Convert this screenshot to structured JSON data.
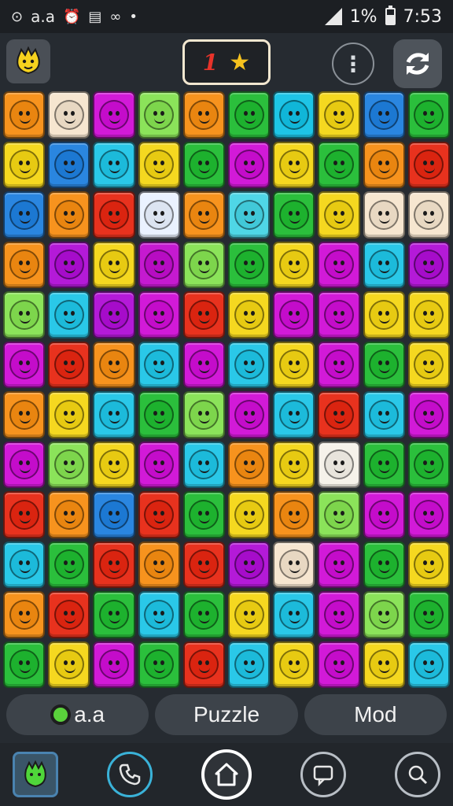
{
  "status_bar": {
    "left_text": "a.a",
    "battery": "1%",
    "time": "7:53"
  },
  "game_bar": {
    "score": "1",
    "score_icon": "star-icon",
    "more_icon": "more-icon",
    "refresh_icon": "refresh-icon",
    "avatar_icon": "yellow-creature-icon"
  },
  "grid": {
    "rows": 12,
    "cols": 10,
    "tiles": [
      [
        "#f7931e",
        "#f6e6d0",
        "#d21ad8",
        "#8be35a",
        "#f7931e",
        "#2bbf3c",
        "#1ec4e6",
        "#f5d820",
        "#2a86e0",
        "#2bbf3c"
      ],
      [
        "#f5d820",
        "#2a86e0",
        "#2ac8e8",
        "#f5d820",
        "#2bbf3c",
        "#d21ad8",
        "#f5d820",
        "#2bbf3c",
        "#f7931e",
        "#e8321e"
      ],
      [
        "#2a86e0",
        "#f7931e",
        "#e8321e",
        "#eaf2ff",
        "#f7931e",
        "#4fd6e6",
        "#2bbf3c",
        "#f5d820",
        "#f6e6d0",
        "#f6e6d0"
      ],
      [
        "#f7931e",
        "#b41ad8",
        "#f5d820",
        "#c51ad0",
        "#8be35a",
        "#2bbf3c",
        "#f5d820",
        "#d21ad8",
        "#2ac8e8",
        "#b41ad8"
      ],
      [
        "#8be35a",
        "#2ac8e8",
        "#b41ad8",
        "#d21ad8",
        "#e8321e",
        "#f5d820",
        "#d21ad8",
        "#d21ad8",
        "#f5d820",
        "#f5d820"
      ],
      [
        "#d21ad8",
        "#e8321e",
        "#f7931e",
        "#2ac8e8",
        "#d21ad8",
        "#2ac8e8",
        "#f5d820",
        "#d21ad8",
        "#2bbf3c",
        "#f5d820"
      ],
      [
        "#f7931e",
        "#f5d820",
        "#2ac8e8",
        "#2bbf3c",
        "#8be35a",
        "#d21ad8",
        "#2ac8e8",
        "#e8321e",
        "#2ac8e8",
        "#d21ad8"
      ],
      [
        "#d21ad8",
        "#8be35a",
        "#f5d820",
        "#d21ad8",
        "#2ac8e8",
        "#f7931e",
        "#f5d820",
        "#f6f2ea",
        "#2bbf3c",
        "#2bbf3c"
      ],
      [
        "#e8321e",
        "#f7931e",
        "#2a86e0",
        "#e8321e",
        "#2bbf3c",
        "#f5d820",
        "#f7931e",
        "#8be35a",
        "#d21ad8",
        "#d21ad8"
      ],
      [
        "#2ac8e8",
        "#2bbf3c",
        "#e8321e",
        "#f7931e",
        "#e8321e",
        "#b41ad8",
        "#f6e6d0",
        "#d21ad8",
        "#2bbf3c",
        "#f5d820"
      ],
      [
        "#f7931e",
        "#e8321e",
        "#2bbf3c",
        "#2ac8e8",
        "#2bbf3c",
        "#f5d820",
        "#2ac8e8",
        "#d21ad8",
        "#8be35a",
        "#2bbf3c"
      ],
      [
        "#2bbf3c",
        "#f5d820",
        "#d21ad8",
        "#2bbf3c",
        "#e8321e",
        "#2ac8e8",
        "#f5d820",
        "#d21ad8",
        "#f5d820",
        "#2ac8e8"
      ]
    ]
  },
  "tabs": [
    {
      "label": "a.a",
      "icon": "creature-icon"
    },
    {
      "label": "Puzzle"
    },
    {
      "label": "Mod"
    }
  ],
  "nav": [
    {
      "icon": "creature-icon"
    },
    {
      "icon": "phone-icon"
    },
    {
      "icon": "home-icon"
    },
    {
      "icon": "chat-icon"
    },
    {
      "icon": "search-icon"
    }
  ]
}
